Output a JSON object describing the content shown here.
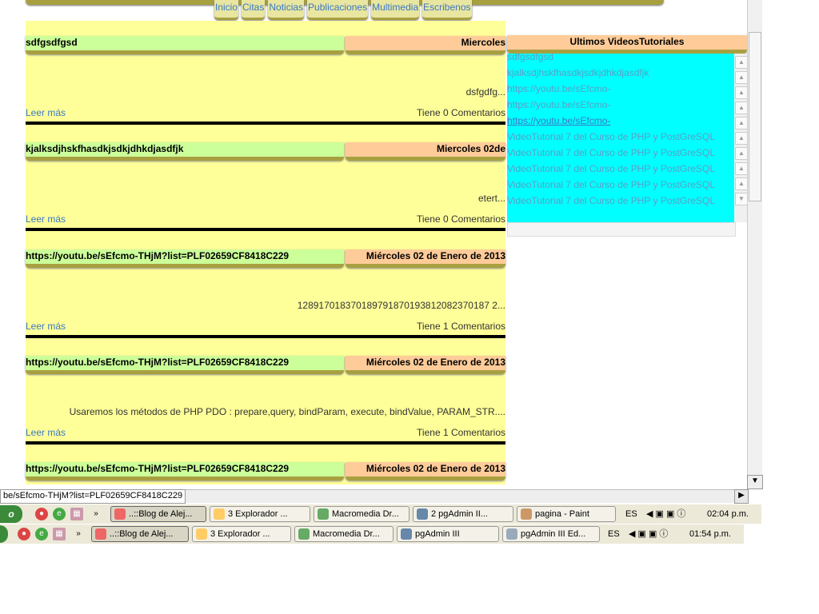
{
  "nav": [
    "Inicio",
    "Citas",
    "Noticias",
    "Publicaciones",
    "Multimedia",
    "Escribenos"
  ],
  "posts": [
    {
      "title": "sdfgsdfgsd",
      "date": "Miercoles",
      "body": "dsfgdfg...",
      "more": "Leer más",
      "comments": "Tiene 0 Comentarios"
    },
    {
      "title": "kjalksdjhskfhasdkjsdkjdhkdjasdfjk",
      "date": "Miercoles 02de",
      "body": "etert...",
      "more": "Leer más",
      "comments": "Tiene 0 Comentarios"
    },
    {
      "title": "https://youtu.be/sEfcmo-THjM?list=PLF02659CF8418C229",
      "date": "Miércoles 02 de Enero de 2013",
      "body": "128917018370189791870193812082370187 2...",
      "more": "Leer más",
      "comments": "Tiene 1 Comentarios"
    },
    {
      "title": "https://youtu.be/sEfcmo-THjM?list=PLF02659CF8418C229",
      "date": "Miércoles 02 de Enero de 2013",
      "body": "Usaremos los métodos de PHP PDO : prepare,query, bindParam, execute, bindValue, PARAM_STR....",
      "more": "Leer más",
      "comments": "Tiene 1 Comentarios"
    },
    {
      "title": "https://youtu.be/sEfcmo-THjM?list=PLF02659CF8418C229",
      "date": "Miércoles 02 de Enero de 2013",
      "body": "",
      "more": "",
      "comments": ""
    }
  ],
  "sidebar": {
    "title": "Ultimos VideosTutoriales",
    "items": [
      "sdfgsdfgsd",
      "kjalksdjhskfhasdkjsdkjdhkdjasdfjk",
      "https://youtu.be/sEfcmo-",
      "https://youtu.be/sEfcmo-",
      "https://youtu.be/sEfcmo-",
      "VideoTutorial 7 del Curso de PHP y PostGreSQL",
      "VideoTutorial 7 del Curso de PHP y PostGreSQL",
      "VideoTutorial 7 del Curso de PHP y PostGreSQL",
      "VideoTutorial 7 del Curso de PHP y PostGreSQL",
      "VideoTutorial 7 del Curso de PHP y PostGreSQL"
    ]
  },
  "status_url": "be/sEfcmo-THjM?list=PLF02659CF8418C229",
  "taskbar1": {
    "buttons": [
      "..::Blog de Alej...",
      "3 Explorador ...",
      "Macromedia Dr...",
      "2 pgAdmin II...",
      "pagina - Paint"
    ],
    "lang": "ES",
    "time": "02:04 p.m."
  },
  "taskbar2": {
    "buttons": [
      "..::Blog de Alej...",
      "3 Explorador ...",
      "Macromedia Dr...",
      "pgAdmin III",
      "pgAdmin III Ed..."
    ],
    "lang": "ES",
    "time": "01:54 p.m."
  }
}
